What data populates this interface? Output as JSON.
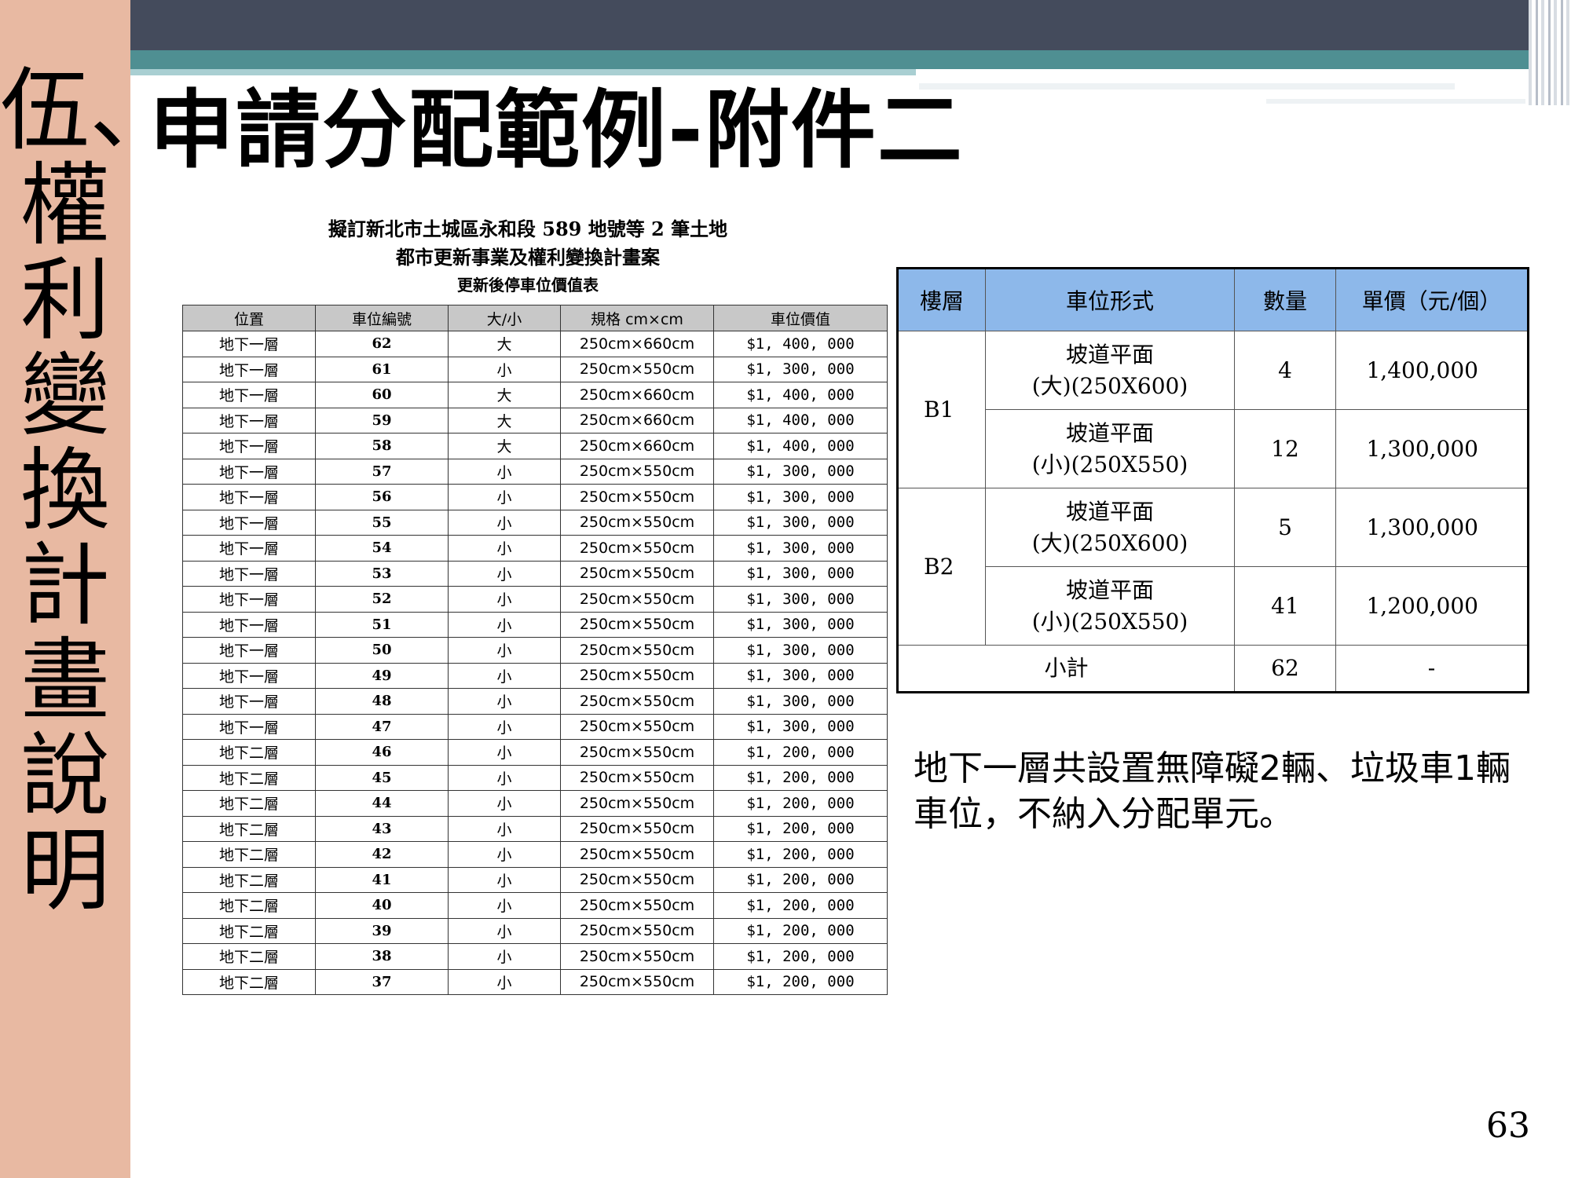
{
  "side_title": "伍、權利變換計畫說明",
  "main_title": "申請分配範例-附件二",
  "document": {
    "title_line1": "擬訂新北市土城區永和段 589 地號等 2 筆土地",
    "title_line2": "都市更新事業及權利變換計畫案",
    "subtitle": "更新後停車位價值表",
    "headers": [
      "位置",
      "車位編號",
      "大/小",
      "規格 cm×cm",
      "車位價值"
    ],
    "rows": [
      [
        "地下一層",
        "62",
        "大",
        "250cm×660cm",
        "$1, 400, 000"
      ],
      [
        "地下一層",
        "61",
        "小",
        "250cm×550cm",
        "$1, 300, 000"
      ],
      [
        "地下一層",
        "60",
        "大",
        "250cm×660cm",
        "$1, 400, 000"
      ],
      [
        "地下一層",
        "59",
        "大",
        "250cm×660cm",
        "$1, 400, 000"
      ],
      [
        "地下一層",
        "58",
        "大",
        "250cm×660cm",
        "$1, 400, 000"
      ],
      [
        "地下一層",
        "57",
        "小",
        "250cm×550cm",
        "$1, 300, 000"
      ],
      [
        "地下一層",
        "56",
        "小",
        "250cm×550cm",
        "$1, 300, 000"
      ],
      [
        "地下一層",
        "55",
        "小",
        "250cm×550cm",
        "$1, 300, 000"
      ],
      [
        "地下一層",
        "54",
        "小",
        "250cm×550cm",
        "$1, 300, 000"
      ],
      [
        "地下一層",
        "53",
        "小",
        "250cm×550cm",
        "$1, 300, 000"
      ],
      [
        "地下一層",
        "52",
        "小",
        "250cm×550cm",
        "$1, 300, 000"
      ],
      [
        "地下一層",
        "51",
        "小",
        "250cm×550cm",
        "$1, 300, 000"
      ],
      [
        "地下一層",
        "50",
        "小",
        "250cm×550cm",
        "$1, 300, 000"
      ],
      [
        "地下一層",
        "49",
        "小",
        "250cm×550cm",
        "$1, 300, 000"
      ],
      [
        "地下一層",
        "48",
        "小",
        "250cm×550cm",
        "$1, 300, 000"
      ],
      [
        "地下一層",
        "47",
        "小",
        "250cm×550cm",
        "$1, 300, 000"
      ],
      [
        "地下二層",
        "46",
        "小",
        "250cm×550cm",
        "$1, 200, 000"
      ],
      [
        "地下二層",
        "45",
        "小",
        "250cm×550cm",
        "$1, 200, 000"
      ],
      [
        "地下二層",
        "44",
        "小",
        "250cm×550cm",
        "$1, 200, 000"
      ],
      [
        "地下二層",
        "43",
        "小",
        "250cm×550cm",
        "$1, 200, 000"
      ],
      [
        "地下二層",
        "42",
        "小",
        "250cm×550cm",
        "$1, 200, 000"
      ],
      [
        "地下二層",
        "41",
        "小",
        "250cm×550cm",
        "$1, 200, 000"
      ],
      [
        "地下二層",
        "40",
        "小",
        "250cm×550cm",
        "$1, 200, 000"
      ],
      [
        "地下二層",
        "39",
        "小",
        "250cm×550cm",
        "$1, 200, 000"
      ],
      [
        "地下二層",
        "38",
        "小",
        "250cm×550cm",
        "$1, 200, 000"
      ],
      [
        "地下二層",
        "37",
        "小",
        "250cm×550cm",
        "$1, 200, 000"
      ]
    ]
  },
  "summary": {
    "headers": [
      "樓層",
      "車位形式",
      "數量",
      "單價（元/個）"
    ],
    "b1_label": "B1",
    "b2_label": "B2",
    "rows": [
      {
        "type": "坡道平面\n(大)(250X600)",
        "qty": "4",
        "price": "1,400,000"
      },
      {
        "type": "坡道平面\n(小)(250X550)",
        "qty": "12",
        "price": "1,300,000"
      },
      {
        "type": "坡道平面\n(大)(250X600)",
        "qty": "5",
        "price": "1,300,000"
      },
      {
        "type": "坡道平面\n(小)(250X550)",
        "qty": "41",
        "price": "1,200,000"
      }
    ],
    "subtotal_label": "小計",
    "subtotal_qty": "62",
    "subtotal_price": "-"
  },
  "note": "地下一層共設置無障礙2輛、垃圾車1輛車位，不納入分配單元。",
  "page_number": "63",
  "colors": {
    "side": "#e8b9a2",
    "header_dark": "#444b5c",
    "header_teal": "#4f8f92",
    "summary_header": "#8db8ea"
  }
}
